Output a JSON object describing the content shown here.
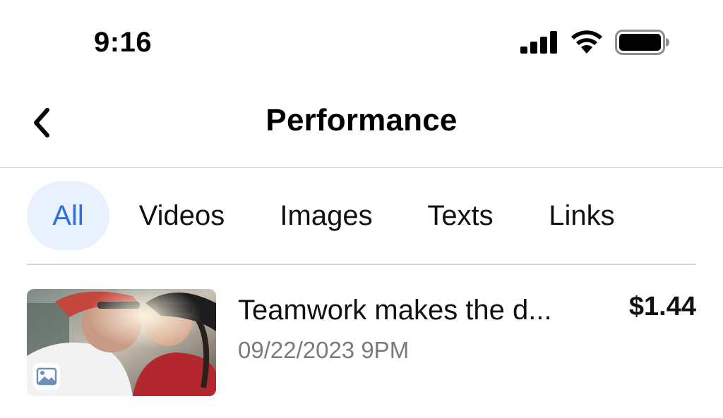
{
  "status_bar": {
    "time": "9:16",
    "icons": [
      "cellular-signal-icon",
      "wifi-icon",
      "battery-icon"
    ]
  },
  "nav": {
    "back_icon": "chevron-left-icon",
    "title": "Performance"
  },
  "tabs": [
    {
      "label": "All",
      "active": true
    },
    {
      "label": "Videos",
      "active": false
    },
    {
      "label": "Images",
      "active": false
    },
    {
      "label": "Texts",
      "active": false
    },
    {
      "label": "Links",
      "active": false
    }
  ],
  "posts": [
    {
      "title": "Teamwork makes the d...",
      "date": "09/22/2023 9PM",
      "amount": "$1.44",
      "type_icon": "image-icon"
    }
  ],
  "colors": {
    "accent": "#2f6fd6",
    "active_tab_bg": "#e8f1fd",
    "secondary_text": "#7a7a7a"
  }
}
